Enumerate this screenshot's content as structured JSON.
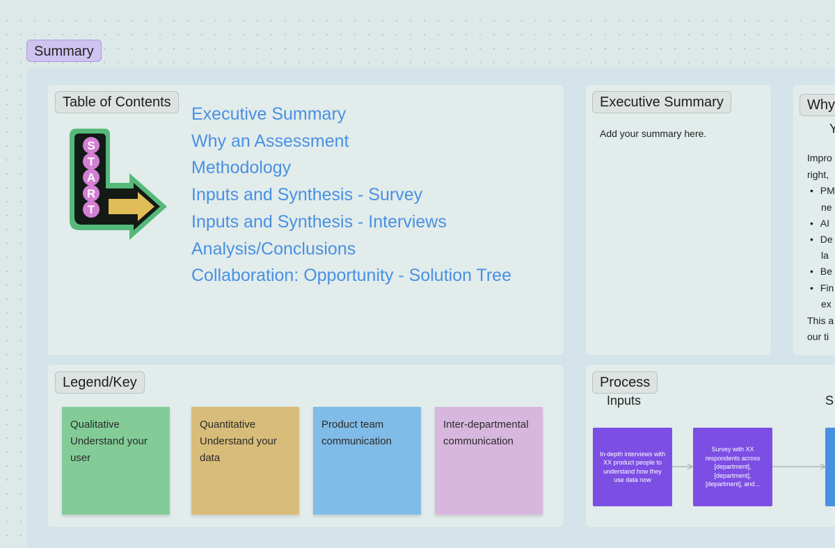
{
  "section": {
    "tag": "Summary"
  },
  "toc": {
    "title": "Table of Contents",
    "start_sign_letters": [
      "S",
      "T",
      "A",
      "R",
      "T"
    ],
    "links": [
      "Executive Summary",
      "Why an Assessment",
      "Methodology",
      "Inputs and Synthesis - Survey",
      "Inputs and Synthesis - Interviews",
      "Analysis/Conclusions",
      "Collaboration: Opportunity - Solution Tree"
    ]
  },
  "executive_summary": {
    "title": "Executive Summary",
    "body": "Add your summary here."
  },
  "why_partial": {
    "title": "Why",
    "subtitle": "Y",
    "intro_lines": [
      "Impro",
      "right,"
    ],
    "bullets": [
      "PM",
      "ne",
      "AI",
      "De",
      "la",
      "Be",
      "Fin",
      "ex"
    ],
    "outro_lines": [
      "This a",
      "our ti"
    ]
  },
  "legend": {
    "title": "Legend/Key",
    "items": [
      {
        "text": "Qualitative Understand your user",
        "color": "#83cc98"
      },
      {
        "text": "Quantitative Understand your data",
        "color": "#d8bc79"
      },
      {
        "text": "Product team communication",
        "color": "#80bce7"
      },
      {
        "text": "Inter-departmental communication",
        "color": "#d8b7de"
      }
    ]
  },
  "process": {
    "title": "Process",
    "inputs_label": "Inputs",
    "second_label_partial": "S",
    "cards": [
      "In-depth interviews with XX product people to understand how they use data now",
      "Survey with XX respondents across [department], [department], [department], and..."
    ],
    "card_color": "#7c4ee4"
  },
  "colors": {
    "link": "#4a90e2",
    "section_tag": "#cfc3ef",
    "canvas": "#dde9e9"
  }
}
